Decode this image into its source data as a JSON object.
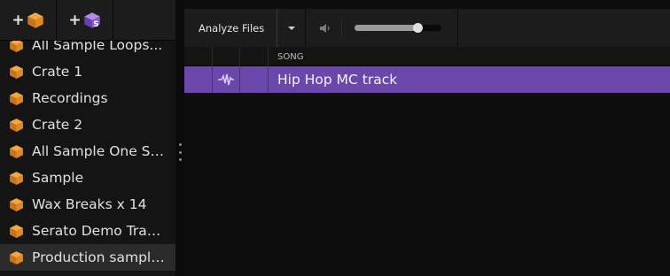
{
  "left_toolbar": {
    "add_crate": {
      "plus": "+",
      "icon": "crate-icon"
    },
    "add_smart_crate": {
      "plus": "+",
      "icon": "smart-crate-icon",
      "badge": "S"
    }
  },
  "crates": [
    {
      "label": "All Sample Loops...",
      "icon": "crate-icon"
    },
    {
      "label": "Crate 1",
      "icon": "crate-icon"
    },
    {
      "label": "Recordings",
      "icon": "crate-icon"
    },
    {
      "label": "Crate 2",
      "icon": "crate-icon"
    },
    {
      "label": "All Sample One Sh...",
      "icon": "crate-icon"
    },
    {
      "label": "Sample",
      "icon": "crate-icon"
    },
    {
      "label": "Wax Breaks x 14",
      "icon": "crate-icon"
    },
    {
      "label": "Serato Demo Tracks",
      "icon": "crate-icon"
    },
    {
      "label": "Production samples",
      "icon": "crate-icon",
      "selected": true
    }
  ],
  "toolbar": {
    "analyze_label": "Analyze Files",
    "dropdown_icon": "chevron-down-icon",
    "volume_icon": "speaker-icon",
    "volume_level": 0.72
  },
  "table": {
    "columns": [
      "",
      "",
      "",
      "SONG"
    ],
    "rows": [
      {
        "waveform_icon": "waveform-icon",
        "song": "Hip Hop MC track",
        "selected": true
      }
    ]
  },
  "colors": {
    "accent": "#6b47ab",
    "crate_orange": "#e08a1e",
    "smart_crate_purple": "#8a5ad6"
  }
}
